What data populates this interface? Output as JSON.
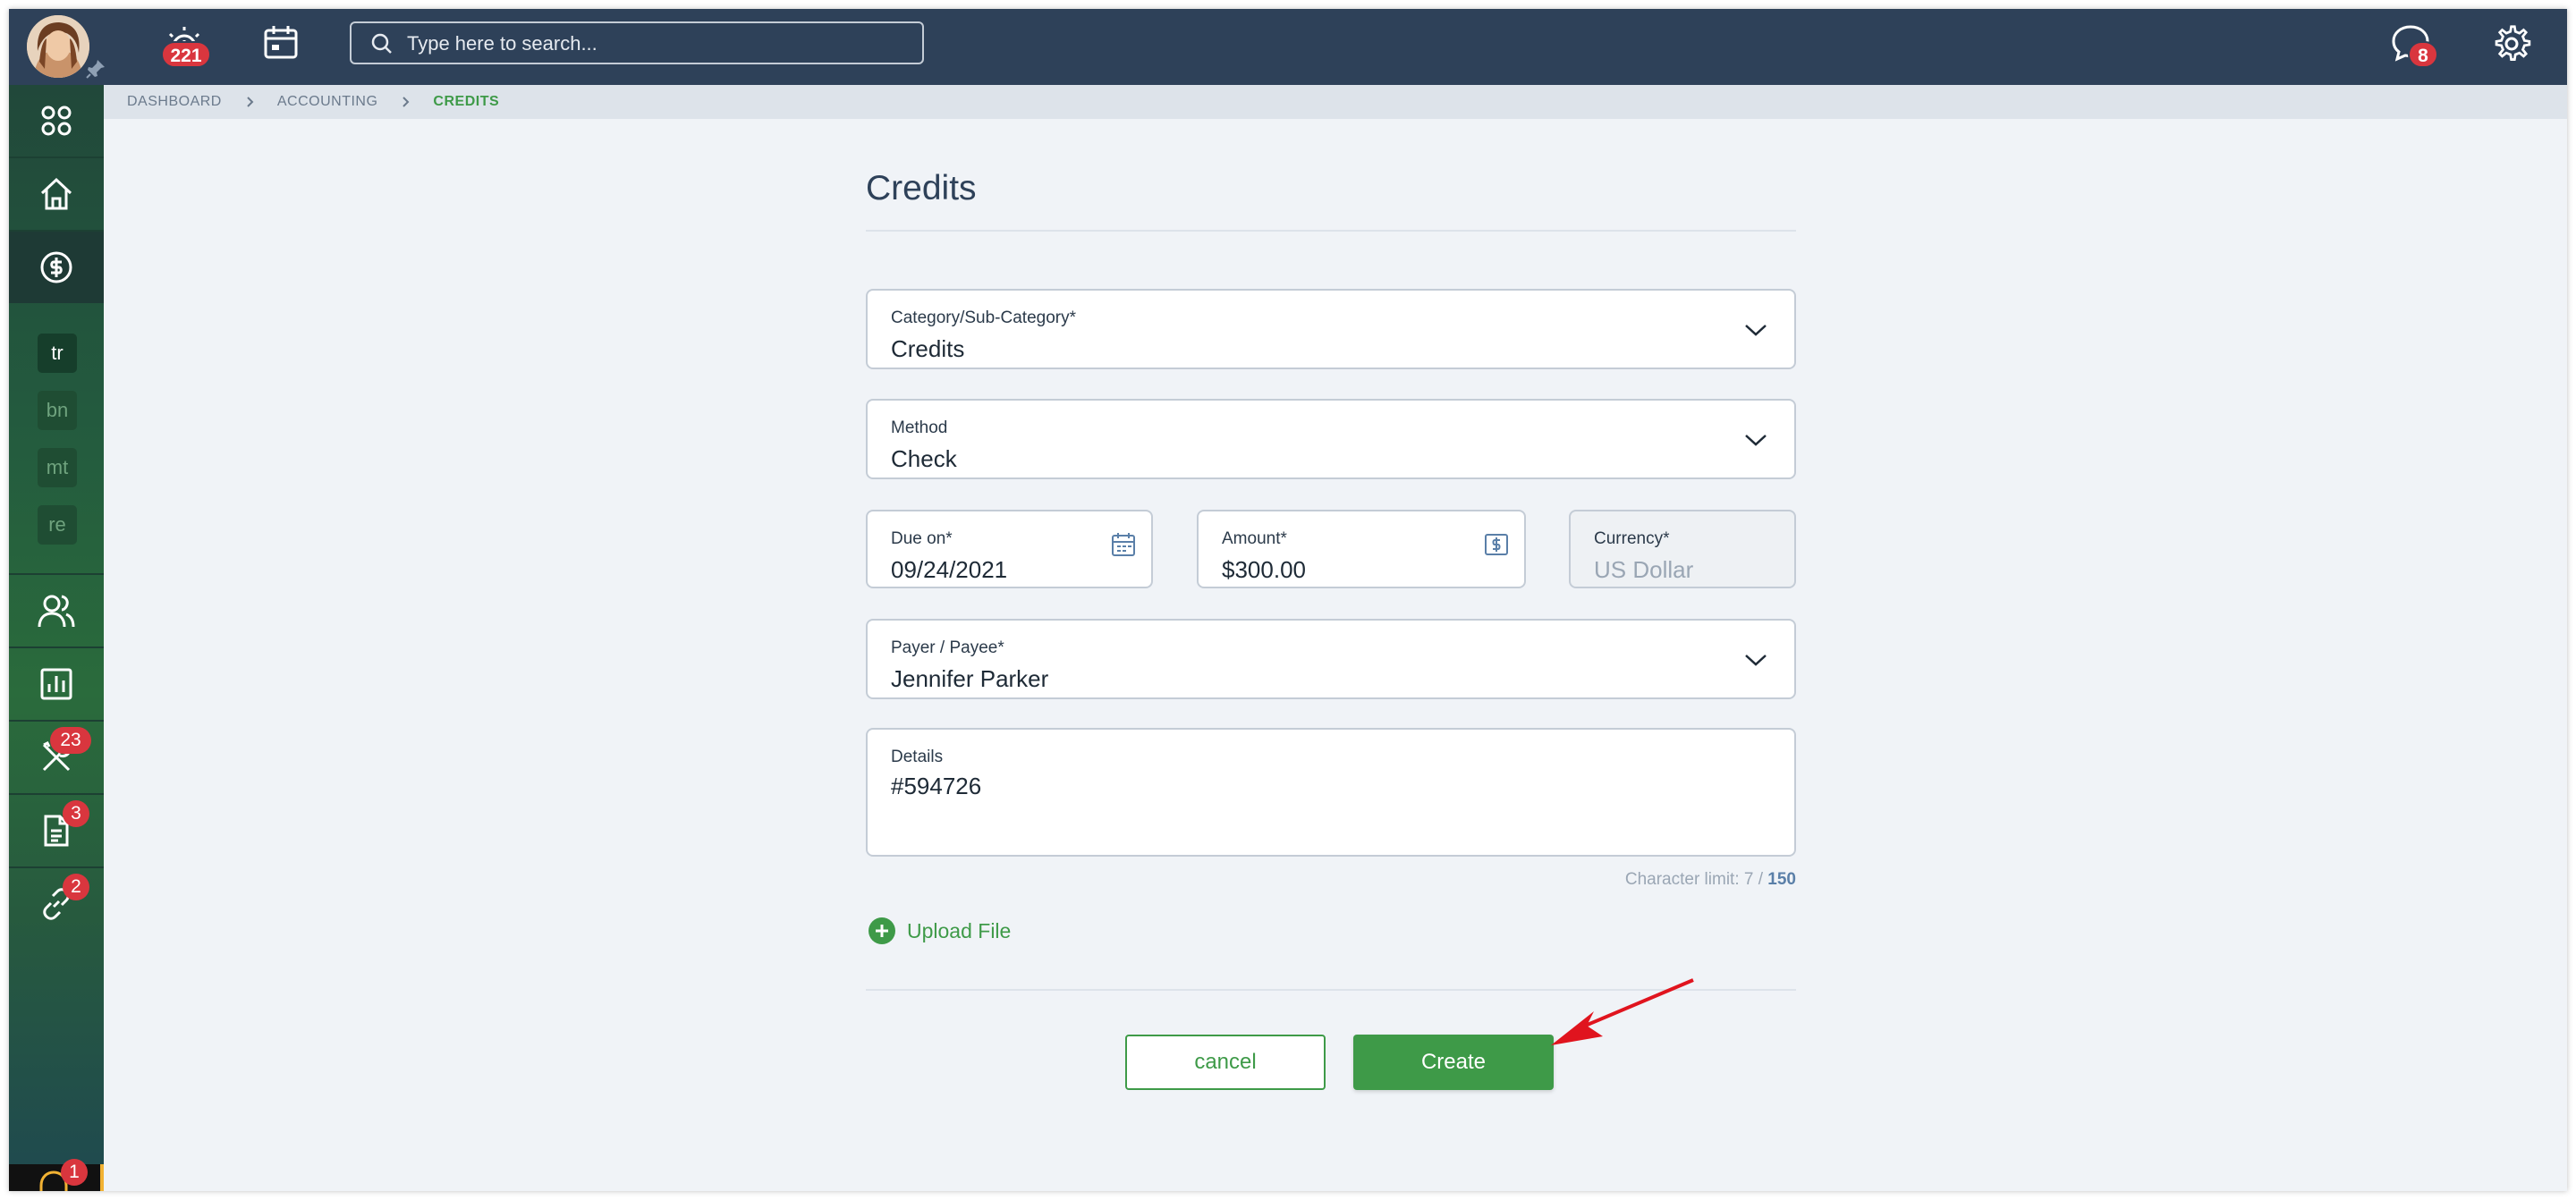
{
  "header": {
    "notifications_count": "221",
    "messages_count": "8",
    "search_placeholder": "Type here to search..."
  },
  "sidebar": {
    "mini_items": [
      "tr",
      "bn",
      "mt",
      "re"
    ],
    "badges": {
      "tools": "23",
      "documents": "3",
      "links": "2",
      "support": "1"
    }
  },
  "breadcrumb": {
    "items": [
      "DASHBOARD",
      "ACCOUNTING"
    ],
    "current": "CREDITS"
  },
  "form": {
    "title": "Credits",
    "category": {
      "label": "Category/Sub-Category*",
      "value": "Credits"
    },
    "method": {
      "label": "Method",
      "value": "Check"
    },
    "due_on": {
      "label": "Due on*",
      "value": "09/24/2021"
    },
    "amount": {
      "label": "Amount*",
      "value": "$300.00"
    },
    "currency": {
      "label": "Currency*",
      "value": "US Dollar"
    },
    "payee": {
      "label": "Payer / Payee*",
      "value": "Jennifer Parker"
    },
    "details": {
      "label": "Details",
      "value": "#594726"
    },
    "char_limit": {
      "prefix": "Character limit: 7 / ",
      "max": "150"
    },
    "upload_label": "Upload File",
    "cancel_label": "cancel",
    "create_label": "Create"
  },
  "colors": {
    "topbar": "#2e4159",
    "accent_green": "#3e9a48",
    "badge_red": "#d9363e",
    "annotation_arrow": "#e0141e"
  }
}
